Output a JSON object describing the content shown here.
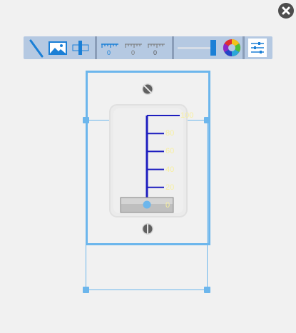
{
  "close": {
    "icon": "close-circle-icon"
  },
  "toolbar": {
    "groups": [
      {
        "name": "style",
        "items": [
          "needle-icon",
          "image-icon",
          "bar-icon"
        ]
      },
      {
        "name": "scales",
        "items": [
          "scale-style-1-icon",
          "scale-style-2-icon",
          "scale-style-3-icon"
        ]
      },
      {
        "name": "value",
        "items": [
          "value-slider-icon",
          "color-wheel-icon"
        ]
      },
      {
        "name": "settings",
        "items": [
          "settings-icon"
        ]
      }
    ]
  },
  "slider": {
    "scale_max": 100,
    "scale_min": 0,
    "tick_labels": [
      "100",
      "80",
      "60",
      "40",
      "20",
      "0"
    ],
    "value": 0,
    "colors": {
      "scale": "#1d1dbf",
      "labels": "#f7ef9e",
      "handle": "#bfbfbf",
      "handle_dot": "#6cb6ec",
      "selection": "#6cb6ec"
    }
  }
}
